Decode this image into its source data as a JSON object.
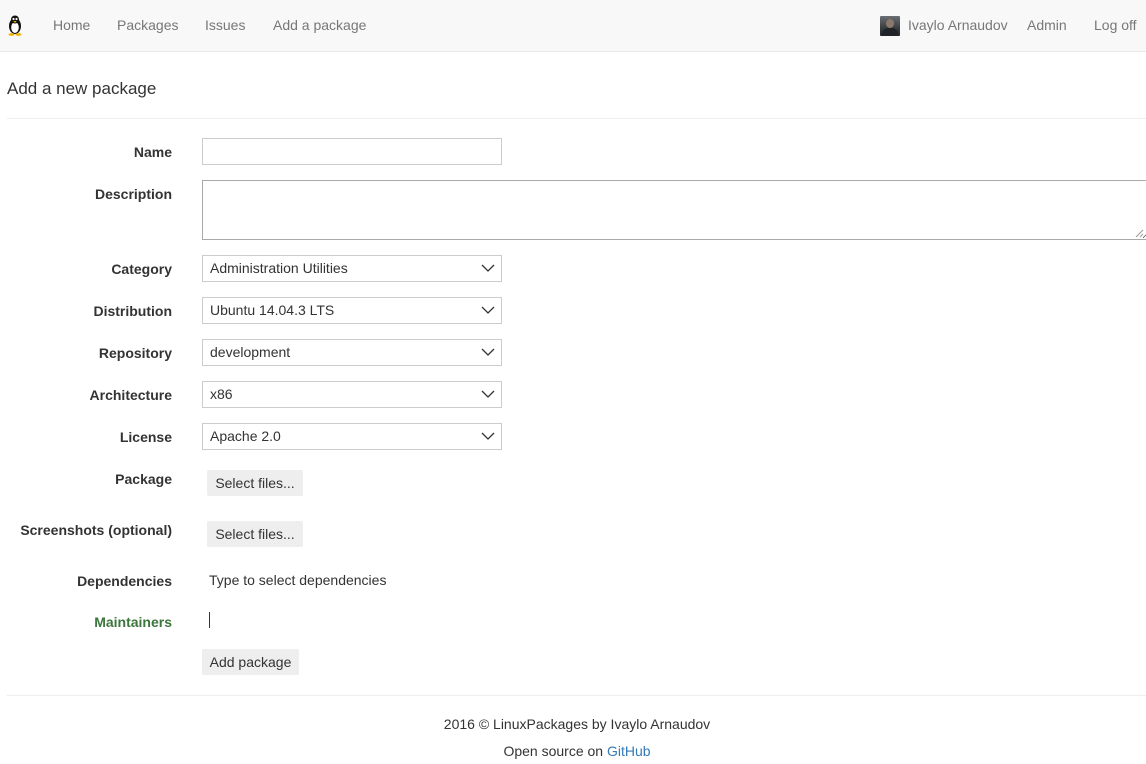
{
  "navbar": {
    "brand_icon": "tux-penguin-icon",
    "links": {
      "home": "Home",
      "packages": "Packages",
      "issues": "Issues",
      "add_package": "Add a package"
    },
    "user": {
      "name": "Ivaylo Arnaudov",
      "admin": "Admin",
      "logoff": "Log off"
    }
  },
  "page": {
    "title": "Add a new package"
  },
  "form": {
    "name_label": "Name",
    "name_value": "",
    "description_label": "Description",
    "description_value": "",
    "category_label": "Category",
    "category_value": "Administration Utilities",
    "distribution_label": "Distribution",
    "distribution_value": "Ubuntu 14.04.3 LTS",
    "repository_label": "Repository",
    "repository_value": "development",
    "architecture_label": "Architecture",
    "architecture_value": "x86",
    "license_label": "License",
    "license_value": "Apache 2.0",
    "package_label": "Package",
    "package_button": "Select files...",
    "screenshots_label": "Screenshots (optional)",
    "screenshots_button": "Select files...",
    "dependencies_label": "Dependencies",
    "dependencies_placeholder": "Type to select dependencies",
    "maintainers_label": "Maintainers",
    "submit_button": "Add package"
  },
  "footer": {
    "copyright": "2016 © LinuxPackages by Ivaylo Arnaudov",
    "open_source_prefix": "Open source on ",
    "github_link": "GitHub"
  },
  "colors": {
    "navbar_bg": "#f8f8f8",
    "nav_link": "#777777",
    "label_success": "#3c763d",
    "link": "#337ab7",
    "button_bg": "#eeeeee"
  }
}
